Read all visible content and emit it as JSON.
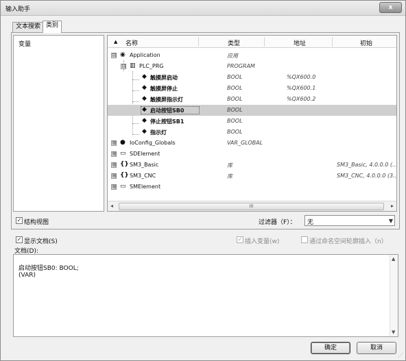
{
  "window": {
    "title": "输入助手",
    "close_label": "x"
  },
  "tabs": [
    {
      "label": "文本搜索"
    },
    {
      "label": "类别"
    }
  ],
  "categories": {
    "items": [
      {
        "label": "变量"
      }
    ]
  },
  "tree": {
    "columns": {
      "name": "名称",
      "type": "类型",
      "address": "地址",
      "initial": "初始"
    },
    "rows": [
      {
        "name": "Application",
        "type": "应用",
        "address": "",
        "initial": "",
        "expander": "⊟",
        "icon": "application-icon"
      },
      {
        "name": "PLC_PRG",
        "type": "PROGRAM",
        "address": "",
        "initial": "",
        "expander": "⊟",
        "icon": "program-icon"
      },
      {
        "name": "触摸屏启动",
        "type": "BOOL",
        "address": "%QX600.0",
        "initial": ""
      },
      {
        "name": "触摸屏停止",
        "type": "BOOL",
        "address": "%QX600.1",
        "initial": ""
      },
      {
        "name": "触摸屏指示灯",
        "type": "BOOL",
        "address": "%QX600.2",
        "initial": ""
      },
      {
        "name": "启动按钮SB0",
        "type": "BOOL",
        "address": "",
        "initial": "",
        "selected": true
      },
      {
        "name": "停止按钮SB1",
        "type": "BOOL",
        "address": "",
        "initial": ""
      },
      {
        "name": "指示灯",
        "type": "BOOL",
        "address": "",
        "initial": ""
      },
      {
        "name": "IoConfig_Globals",
        "type": "VAR_GLOBAL",
        "address": "",
        "initial": "",
        "expander": "⊞",
        "icon": "global-vars-icon"
      },
      {
        "name": "SDElement",
        "type": "",
        "address": "",
        "initial": "",
        "expander": "⊞",
        "icon": "folder-icon"
      },
      {
        "name": "SM3_Basic",
        "type": "库",
        "address": "",
        "initial": "SM3_Basic, 4.0.0.0 (...",
        "expander": "⊞",
        "icon": "library-icon"
      },
      {
        "name": "SM3_CNC",
        "type": "库",
        "address": "",
        "initial": "SM3_CNC, 4.0.0.0 (3...",
        "expander": "⊞",
        "icon": "library-icon"
      },
      {
        "name": "SMElement",
        "type": "",
        "address": "",
        "initial": "",
        "expander": "⊞",
        "icon": "folder-icon"
      }
    ],
    "scrollbar_grip": "III"
  },
  "options": {
    "structured_view": {
      "label": "结构视图",
      "checked": true
    },
    "filter": {
      "label": "过滤器（F）：",
      "value": "无"
    },
    "show_docs": {
      "label": "显示文档(S)",
      "checked": true
    },
    "insert_variable": {
      "label": "插入变量(w)",
      "checked": true,
      "enabled": false
    },
    "insert_with_namespace": {
      "label": "通过命名空间轮廓插入（n）",
      "checked": false,
      "enabled": false
    }
  },
  "documentation": {
    "label": "文档(D):",
    "lines": [
      "启动按钮SB0: BOOL;",
      "(VAR)"
    ]
  },
  "buttons": {
    "ok": "确定",
    "cancel": "取消"
  }
}
